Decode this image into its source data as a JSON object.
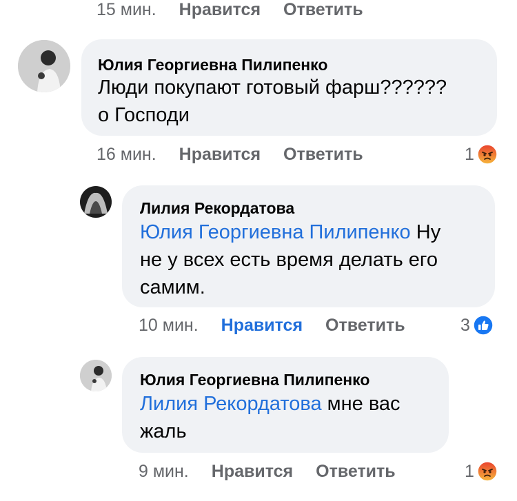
{
  "comments": [
    {
      "time": "15 мин.",
      "like_label": "Нравится",
      "reply_label": "Ответить"
    },
    {
      "author": "Юлия Георгиевна Пилипенко",
      "line1": "Люди покупают готовый фарш??????",
      "line2": "о Господи",
      "time": "16 мин.",
      "like_label": "Нравится",
      "reply_label": "Ответить",
      "reaction_count": "1",
      "reaction_icon": "angry-reaction-icon"
    },
    {
      "author": "Лилия Рекордатова",
      "mention": "Юлия Георгиевна Пилипенко",
      "line1_rest": " Ну",
      "line2": "не у всех есть время делать его",
      "line3": "самим.",
      "time": "10 мин.",
      "like_label": "Нравится",
      "reply_label": "Ответить",
      "reaction_count": "3",
      "reaction_icon": "like-reaction-icon",
      "liked": true
    },
    {
      "author": "Юлия Георгиевна Пилипенко",
      "mention": "Лилия Рекордатова",
      "line1_rest": " мне вас",
      "line2": "жаль",
      "time": "9 мин.",
      "like_label": "Нравится",
      "reply_label": "Ответить",
      "reaction_count": "1",
      "reaction_icon": "angry-reaction-icon"
    }
  ],
  "colors": {
    "bubble": "#f0f2f5",
    "link": "#216fdb",
    "meta": "#65676b",
    "angry": "#f2692a",
    "like": "#1877f2"
  }
}
